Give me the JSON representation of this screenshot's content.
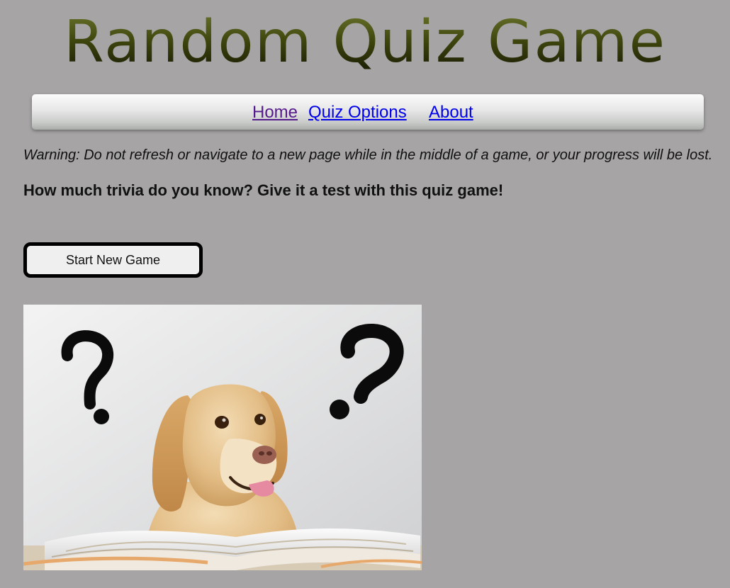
{
  "header": {
    "title": "Random Quiz Game"
  },
  "nav": {
    "items": [
      {
        "label": "Home"
      },
      {
        "label": "Quiz Options"
      },
      {
        "label": "About"
      }
    ]
  },
  "main": {
    "warning": "Warning: Do not refresh or navigate to a new page while in the middle of a game, or your progress will be lost.",
    "tagline": "How much trivia do you know? Give it a test with this quiz game!",
    "start_button": "Start New Game",
    "hero_image": "golden retriever puzzled between two question marks, behind open books"
  },
  "colors": {
    "background": "#a6a4a5",
    "link": "#0000ee",
    "visited_link": "#551a8b",
    "title": "#3a4210"
  }
}
